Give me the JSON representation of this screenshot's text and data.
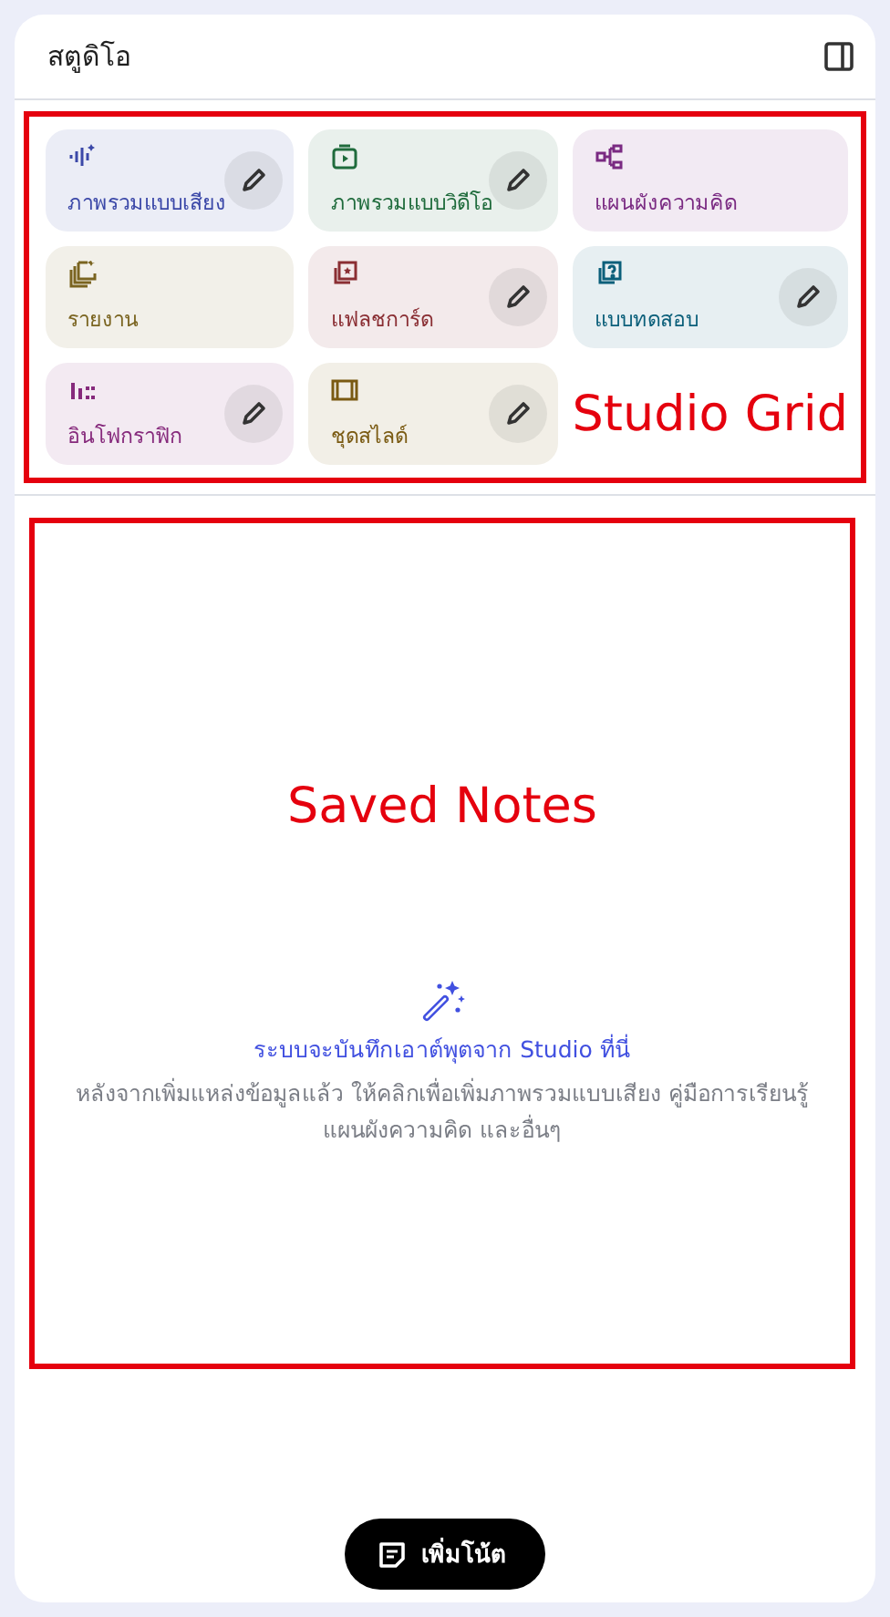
{
  "panel": {
    "title": "สตูดิโอ"
  },
  "studio_tiles": [
    {
      "label": "ภาพรวมแบบเสียง",
      "kind": "audio",
      "color": "#3b48a8",
      "editable": true
    },
    {
      "label": "ภาพรวมแบบวิดีโอ",
      "kind": "video",
      "color": "#1f6b3c",
      "editable": true
    },
    {
      "label": "แผนผังความคิด",
      "kind": "mindmap",
      "color": "#7a2a82",
      "editable": false
    },
    {
      "label": "รายงาน",
      "kind": "report",
      "color": "#7a6420",
      "editable": false
    },
    {
      "label": "แฟลชการ์ด",
      "kind": "flashcard",
      "color": "#8a2e33",
      "editable": true
    },
    {
      "label": "แบบทดสอบ",
      "kind": "quiz",
      "color": "#0b5f7a",
      "editable": true
    },
    {
      "label": "อินโฟกราฟิก",
      "kind": "infographic",
      "color": "#862a7c",
      "editable": true
    },
    {
      "label": "ชุดสไลด์",
      "kind": "slides",
      "color": "#7a5a12",
      "editable": true
    }
  ],
  "annotations": [
    {
      "label": "Studio Grid"
    },
    {
      "label": "Saved Notes"
    }
  ],
  "empty_state": {
    "title": "ระบบจะบันทึกเอาต์พุตจาก Studio ที่นี่",
    "description": "หลังจากเพิ่มแหล่งข้อมูลแล้ว ให้คลิกเพื่อเพิ่มภาพรวมแบบเสียง คู่มือการเรียนรู้ แผนผังความคิด และอื่นๆ"
  },
  "add_note_button": {
    "label": "เพิ่มโน้ต"
  }
}
